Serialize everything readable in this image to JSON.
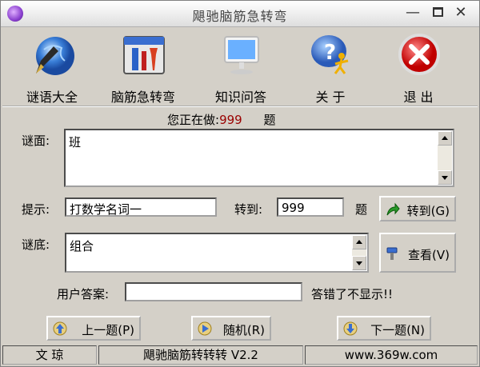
{
  "window": {
    "title": "飓驰脑筋急转弯"
  },
  "toolbar": {
    "items": [
      {
        "label": "谜语大全",
        "icon": "pen-globe-icon"
      },
      {
        "label": "脑筋急转弯",
        "icon": "toolbox-icon"
      },
      {
        "label": "知识问答",
        "icon": "monitor-icon"
      },
      {
        "label": "关  于",
        "icon": "help-runner-icon"
      },
      {
        "label": "退  出",
        "icon": "exit-x-icon"
      }
    ]
  },
  "progress": {
    "prefix": "您正在做:",
    "number": "999",
    "suffix": "题"
  },
  "question": {
    "label": "谜面:",
    "text": "班"
  },
  "hint": {
    "label": "提示:",
    "value": "打数学名词一"
  },
  "goto": {
    "label": "转到:",
    "value": "999",
    "suffix": "题",
    "button": "转到(G)"
  },
  "answer": {
    "label": "谜底:",
    "text": "组合",
    "button": "查看(V)"
  },
  "user_answer": {
    "label": "用户答案:",
    "value": "",
    "note": "答错了不显示!!"
  },
  "nav": {
    "prev": "上一题(P)",
    "random": "随机(R)",
    "next": "下一题(N)"
  },
  "status": {
    "author": "文  琼",
    "app": "飓驰脑筋转转转 V2.2",
    "site": "www.369w.com"
  }
}
